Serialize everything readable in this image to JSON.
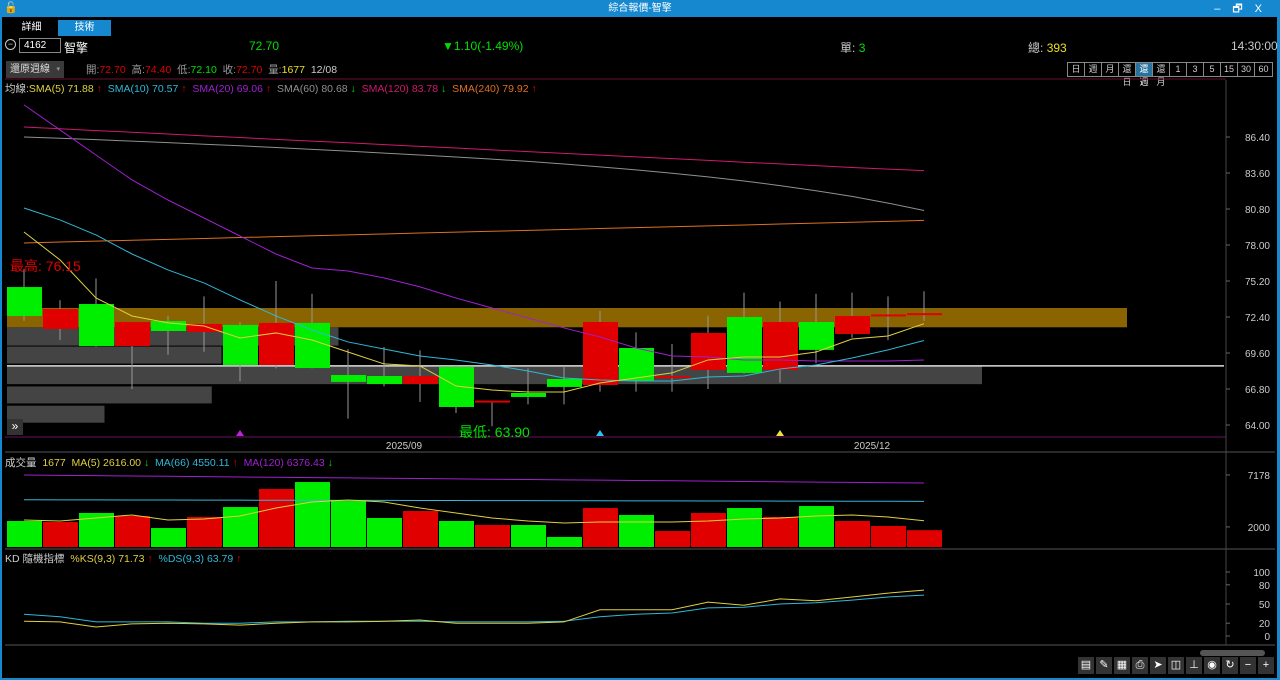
{
  "window": {
    "title": "綜合報價-智擎",
    "lock_icon": "lock-icon",
    "minimize": "–",
    "restore": "🗗",
    "close": "X"
  },
  "tabs": [
    {
      "label": "詳細"
    },
    {
      "label": "技術"
    }
  ],
  "quote": {
    "code": "4162",
    "name": "智擎",
    "price": "72.70",
    "change": "▼1.10(-1.49%)",
    "single_label": "單:",
    "single_value": "3",
    "total_label": "總:",
    "total_value": "393",
    "time": "14:30:00"
  },
  "info": {
    "restore_select": "還原週線",
    "open_label": "開:",
    "open": "72.70",
    "high_label": "高:",
    "high": "74.40",
    "low_label": "低:",
    "low": "72.10",
    "close_label": "收:",
    "close": "72.70",
    "vol_label": "量:",
    "vol": "1677",
    "date": "12/08"
  },
  "timeframes": [
    "日",
    "週",
    "月",
    "還日",
    "還週",
    "還月",
    "1",
    "3",
    "5",
    "15",
    "30",
    "60"
  ],
  "active_timeframe": "還週",
  "colors": {
    "up": "#e00000",
    "down": "#00ee00",
    "sma5": "#e0d040",
    "sma10": "#30b8d8",
    "sma20": "#a020d0",
    "sma60": "#909090",
    "sma120": "#d01870",
    "sma240": "#e07020",
    "band": "#8a6400"
  },
  "legend": {
    "prefix": "均線:",
    "sma5": "SMA(5) 71.88",
    "sma10": "SMA(10) 70.57",
    "sma20": "SMA(20) 69.06",
    "sma60": "SMA(60) 80.68",
    "sma120": "SMA(120) 83.78",
    "sma240": "SMA(240) 79.92",
    "up": "↑",
    "down": "↓"
  },
  "annotations": {
    "max": "最高: 76.15",
    "min": "最低: 63.90"
  },
  "volume_legend": {
    "title": "成交量",
    "value": "1677",
    "ma5": "MA(5) 2616.00",
    "ma66": "MA(66) 4550.11",
    "ma120": "MA(120) 6376.43"
  },
  "kd_legend": {
    "title": "KD 隨機指標",
    "k": "%KS(9,3) 71.73",
    "d": "%DS(9,3) 63.79"
  },
  "chart_data": {
    "type": "candlestick",
    "price_axis": {
      "range": [
        64.0,
        86.4
      ],
      "ticks": [
        "86.40",
        "83.60",
        "80.80",
        "78.00",
        "75.20",
        "72.40",
        "69.60",
        "66.80",
        "64.00"
      ]
    },
    "date_labels": [
      {
        "index": 11,
        "text": "2025/09"
      },
      {
        "index": 24,
        "text": "2025/12"
      }
    ],
    "candles": [
      [
        74.73,
        72.48,
        76.15,
        72.1
      ],
      [
        71.47,
        73.02,
        73.7,
        70.6
      ],
      [
        73.41,
        70.14,
        75.4,
        70.1
      ],
      [
        70.14,
        72.01,
        72.0,
        66.8
      ],
      [
        72.09,
        71.31,
        72.5,
        69.45
      ],
      [
        71.23,
        71.86,
        74.0,
        69.7
      ],
      [
        71.78,
        68.67,
        72.0,
        67.4
      ],
      [
        68.67,
        71.94,
        75.2,
        68.4
      ],
      [
        71.94,
        68.43,
        74.2,
        68.4
      ],
      [
        67.89,
        67.35,
        69.9,
        64.5
      ],
      [
        67.81,
        67.19,
        70.07,
        67.0
      ],
      [
        67.19,
        67.81,
        69.8,
        65.8
      ],
      [
        68.51,
        65.4,
        68.6,
        64.93
      ],
      [
        65.8,
        65.9,
        65.9,
        63.9
      ],
      [
        66.49,
        66.18,
        68.4,
        65.6
      ],
      [
        67.58,
        66.96,
        68.5,
        65.6
      ],
      [
        67.11,
        72.01,
        72.87,
        66.6
      ],
      [
        69.99,
        67.42,
        71.2,
        66.6
      ],
      [
        67.7,
        67.8,
        70.3,
        66.6
      ],
      [
        68.28,
        71.16,
        72.5,
        66.8
      ],
      [
        72.4,
        68.05,
        74.3,
        68.0
      ],
      [
        68.28,
        72.01,
        73.6,
        67.3
      ],
      [
        72.01,
        69.84,
        74.2,
        68.8
      ],
      [
        71.08,
        72.48,
        74.3,
        70.8
      ],
      [
        72.48,
        72.6,
        74.0,
        70.6
      ],
      [
        72.6,
        72.7,
        74.4,
        72.1
      ]
    ],
    "sma5": [
      79.01,
      76.84,
      73.88,
      72.48,
      71.94,
      71.7,
      70.77,
      71.16,
      70.61,
      69.68,
      68.75,
      68.59,
      67.03,
      66.72,
      66.57,
      66.57,
      67.27,
      67.66,
      68.05,
      69.06,
      69.29,
      69.29,
      69.68,
      70.69,
      70.92,
      71.88
    ],
    "sma10": [
      80.88,
      79.95,
      78.78,
      77.3,
      76.06,
      75.05,
      73.73,
      72.48,
      71.39,
      70.46,
      69.91,
      69.37,
      69.06,
      68.67,
      68.2,
      67.66,
      67.5,
      67.42,
      67.42,
      67.73,
      67.81,
      68.36,
      68.67,
      69.21,
      69.84,
      70.57
    ],
    "sma20": [
      88.9,
      86.95,
      85.0,
      83.06,
      81.5,
      80.1,
      78.7,
      77.3,
      76.21,
      75.98,
      75.44,
      74.74,
      73.88,
      73.1,
      72.32,
      71.55,
      70.85,
      69.99,
      69.37,
      69.29,
      69.06,
      69.06,
      68.98,
      68.98,
      68.98,
      69.06
    ],
    "sma60": [
      86.4,
      86.3,
      86.2,
      86.08,
      85.96,
      85.84,
      85.72,
      85.58,
      85.44,
      85.3,
      85.15,
      85.0,
      84.84,
      84.68,
      84.5,
      84.3,
      84.08,
      83.84,
      83.58,
      83.3,
      82.98,
      82.62,
      82.22,
      81.78,
      81.26,
      80.68
    ],
    "sma120": [
      87.18,
      87.04,
      86.9,
      86.77,
      86.63,
      86.49,
      86.36,
      86.22,
      86.08,
      85.95,
      85.81,
      85.67,
      85.54,
      85.4,
      85.26,
      85.13,
      84.99,
      84.85,
      84.72,
      84.58,
      84.44,
      84.31,
      84.17,
      84.03,
      83.9,
      83.78
    ],
    "sma240": [
      78.16,
      78.23,
      78.3,
      78.37,
      78.44,
      78.51,
      78.58,
      78.65,
      78.72,
      78.79,
      78.86,
      78.93,
      79.0,
      79.07,
      79.14,
      79.21,
      79.28,
      79.35,
      79.42,
      79.49,
      79.56,
      79.63,
      79.7,
      79.77,
      79.84,
      79.92
    ],
    "signals": [
      {
        "index": 6,
        "color": "#c020e0"
      },
      {
        "index": 16,
        "color": "#30c0f0"
      },
      {
        "index": 21,
        "color": "#f0e040"
      }
    ],
    "resistance_band": [
      71.6,
      73.1
    ],
    "support_line": 68.6,
    "volume_profile": [
      {
        "range": [
          71.6,
          70.1
        ],
        "weight": 0.34
      },
      {
        "range": [
          70.1,
          68.7
        ],
        "weight": 0.22
      },
      {
        "range": [
          68.6,
          67.1
        ],
        "weight": 1.0
      },
      {
        "range": [
          67.0,
          65.6
        ],
        "weight": 0.21
      },
      {
        "range": [
          65.5,
          64.1
        ],
        "weight": 0.1
      }
    ],
    "volume": {
      "axis_ticks": [
        7178,
        2000
      ],
      "values": [
        2590,
        2490,
        3390,
        3090,
        1890,
        2990,
        3980,
        5780,
        6470,
        4580,
        2890,
        3590,
        2590,
        2190,
        2190,
        1000,
        3880,
        3190,
        1590,
        3390,
        3880,
        2990,
        4080,
        2590,
        2090,
        1677
      ],
      "ma5": [
        2690,
        2590,
        2890,
        3190,
        2690,
        2790,
        3090,
        3880,
        4480,
        4680,
        4480,
        3880,
        3390,
        2890,
        2590,
        2390,
        2490,
        2490,
        2490,
        2590,
        2790,
        2890,
        3090,
        3190,
        2990,
        2616
      ],
      "ma66": [
        4700,
        4694,
        4688,
        4682,
        4676,
        4670,
        4664,
        4658,
        4652,
        4646,
        4640,
        4634,
        4628,
        4622,
        4616,
        4610,
        4604,
        4598,
        4592,
        4586,
        4580,
        4574,
        4568,
        4562,
        4556,
        4550
      ],
      "ma120": [
        7170,
        7138,
        7106,
        7074,
        7042,
        7010,
        6978,
        6946,
        6914,
        6882,
        6850,
        6818,
        6786,
        6754,
        6722,
        6690,
        6658,
        6626,
        6594,
        6562,
        6530,
        6498,
        6466,
        6434,
        6402,
        6376
      ]
    },
    "kd": {
      "axis_ticks": [
        100,
        80,
        50,
        20,
        0
      ],
      "k": [
        23,
        22,
        14,
        19,
        20,
        19,
        17,
        20,
        22,
        22,
        23,
        25,
        20,
        20,
        20,
        22,
        41,
        41,
        41,
        53,
        48,
        58,
        55,
        61,
        67,
        71.73
      ],
      "d": [
        34,
        30,
        22,
        22,
        22,
        20,
        20,
        22,
        22,
        23,
        23,
        23,
        22,
        22,
        22,
        23,
        30,
        34,
        36,
        44,
        45,
        50,
        52,
        56,
        61,
        63.79
      ]
    }
  },
  "toolbar": [
    "report-icon",
    "draw-icon",
    "table-search-icon",
    "print-icon",
    "cursor-icon",
    "layout-icon",
    "indicator-icon",
    "eye-icon",
    "refresh-icon",
    "zoom-out-icon",
    "zoom-in-icon"
  ]
}
